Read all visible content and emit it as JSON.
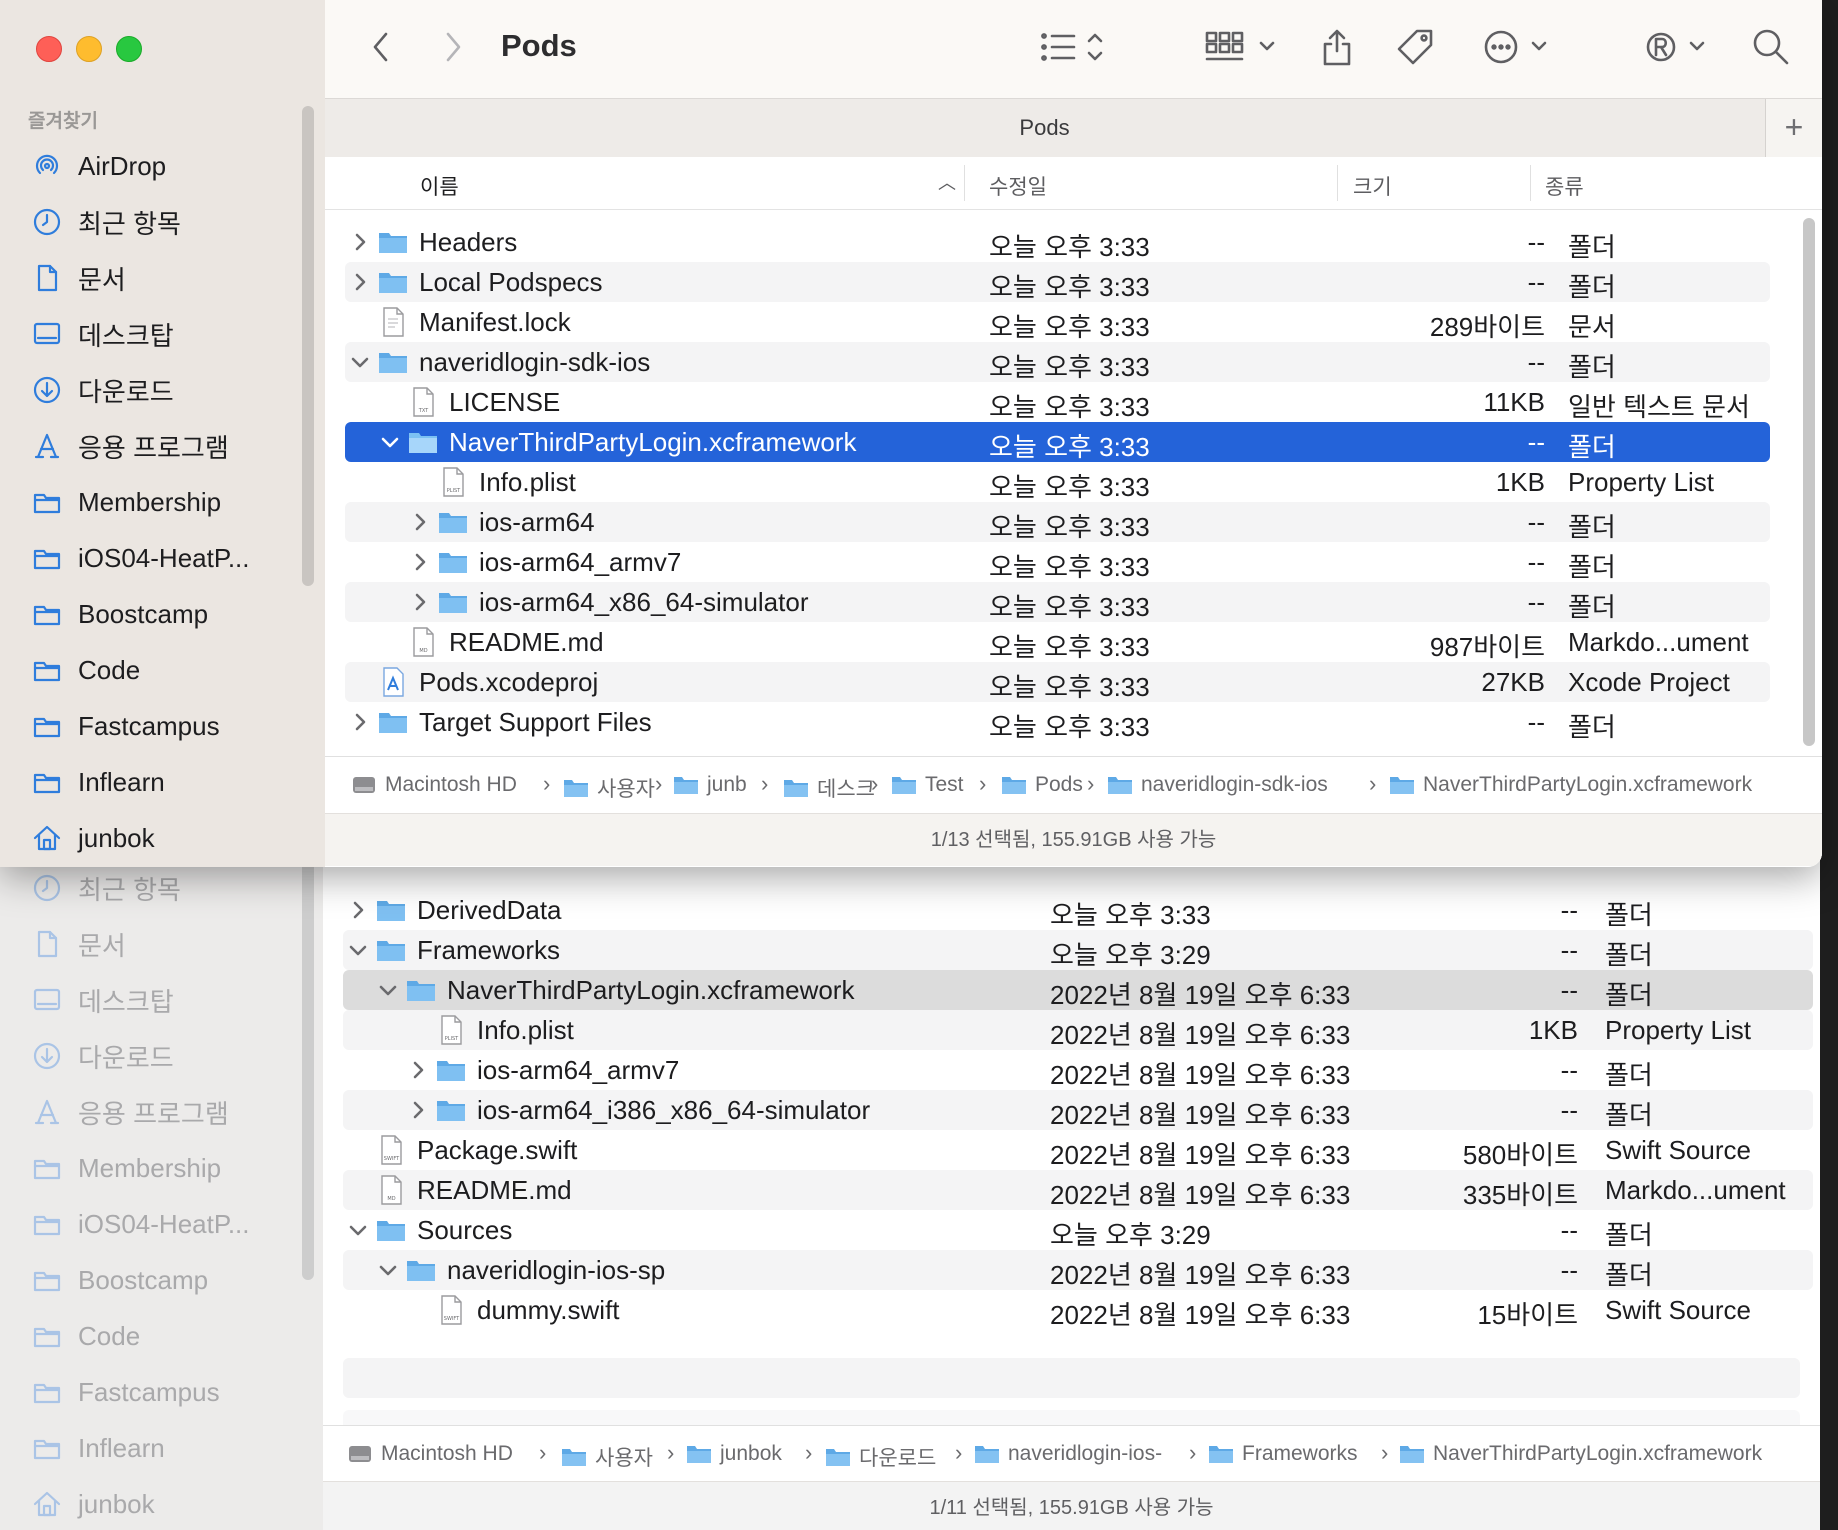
{
  "front": {
    "toolbar": {
      "title": "Pods"
    },
    "tab": {
      "label": "Pods",
      "plus": "+"
    },
    "sidebar": {
      "section": "즐겨찾기",
      "items": [
        {
          "label": "AirDrop",
          "icon": "airdrop-icon"
        },
        {
          "label": "최근 항목",
          "icon": "clock-icon"
        },
        {
          "label": "문서",
          "icon": "document-icon"
        },
        {
          "label": "데스크탑",
          "icon": "desktop-icon"
        },
        {
          "label": "다운로드",
          "icon": "download-icon"
        },
        {
          "label": "응용 프로그램",
          "icon": "applications-icon"
        },
        {
          "label": "Membership",
          "icon": "folder-icon"
        },
        {
          "label": "iOS04-HeatP...",
          "icon": "folder-icon"
        },
        {
          "label": "Boostcamp",
          "icon": "folder-icon"
        },
        {
          "label": "Code",
          "icon": "folder-icon"
        },
        {
          "label": "Fastcampus",
          "icon": "folder-icon"
        },
        {
          "label": "Inflearn",
          "icon": "folder-icon"
        },
        {
          "label": "junbok",
          "icon": "home-icon"
        }
      ]
    },
    "columns": {
      "name": "이름",
      "modified": "수정일",
      "size": "크기",
      "kind": "종류"
    },
    "rows": [
      {
        "name": "Headers",
        "date": "오늘 오후 3:33",
        "size": "--",
        "kind": "폴더"
      },
      {
        "name": "Local Podspecs",
        "date": "오늘 오후 3:33",
        "size": "--",
        "kind": "폴더"
      },
      {
        "name": "Manifest.lock",
        "date": "오늘 오후 3:33",
        "size": "289바이트",
        "kind": "문서"
      },
      {
        "name": "naveridlogin-sdk-ios",
        "date": "오늘 오후 3:33",
        "size": "--",
        "kind": "폴더"
      },
      {
        "name": "LICENSE",
        "date": "오늘 오후 3:33",
        "size": "11KB",
        "kind": "일반 텍스트 문서"
      },
      {
        "name": "NaverThirdPartyLogin.xcframework",
        "date": "오늘 오후 3:33",
        "size": "--",
        "kind": "폴더"
      },
      {
        "name": "Info.plist",
        "date": "오늘 오후 3:33",
        "size": "1KB",
        "kind": "Property List"
      },
      {
        "name": "ios-arm64",
        "date": "오늘 오후 3:33",
        "size": "--",
        "kind": "폴더"
      },
      {
        "name": "ios-arm64_armv7",
        "date": "오늘 오후 3:33",
        "size": "--",
        "kind": "폴더"
      },
      {
        "name": "ios-arm64_x86_64-simulator",
        "date": "오늘 오후 3:33",
        "size": "--",
        "kind": "폴더"
      },
      {
        "name": "README.md",
        "date": "오늘 오후 3:33",
        "size": "987바이트",
        "kind": "Markdo...ument"
      },
      {
        "name": "Pods.xcodeproj",
        "date": "오늘 오후 3:33",
        "size": "27KB",
        "kind": "Xcode Project"
      },
      {
        "name": "Target Support Files",
        "date": "오늘 오후 3:33",
        "size": "--",
        "kind": "폴더"
      }
    ],
    "path": [
      "Macintosh HD",
      "사용자",
      "junb",
      "데스크",
      "Test",
      "Pods",
      "naveridlogin-sdk-ios",
      "NaverThirdPartyLogin.xcframework"
    ],
    "status": "1/13 선택됨, 155.91GB 사용 가능"
  },
  "back": {
    "sidebar": {
      "items": [
        {
          "label": "최근 항목",
          "icon": "clock-icon"
        },
        {
          "label": "문서",
          "icon": "document-icon"
        },
        {
          "label": "데스크탑",
          "icon": "desktop-icon"
        },
        {
          "label": "다운로드",
          "icon": "download-icon"
        },
        {
          "label": "응용 프로그램",
          "icon": "applications-icon"
        },
        {
          "label": "Membership",
          "icon": "folder-icon"
        },
        {
          "label": "iOS04-HeatP...",
          "icon": "folder-icon"
        },
        {
          "label": "Boostcamp",
          "icon": "folder-icon"
        },
        {
          "label": "Code",
          "icon": "folder-icon"
        },
        {
          "label": "Fastcampus",
          "icon": "folder-icon"
        },
        {
          "label": "Inflearn",
          "icon": "folder-icon"
        },
        {
          "label": "junbok",
          "icon": "home-icon"
        }
      ]
    },
    "rows": [
      {
        "name": "DerivedData",
        "date": "오늘 오후 3:33",
        "size": "--",
        "kind": "폴더"
      },
      {
        "name": "Frameworks",
        "date": "오늘 오후 3:29",
        "size": "--",
        "kind": "폴더"
      },
      {
        "name": "NaverThirdPartyLogin.xcframework",
        "date": "2022년 8월 19일 오후 6:33",
        "size": "--",
        "kind": "폴더"
      },
      {
        "name": "Info.plist",
        "date": "2022년 8월 19일 오후 6:33",
        "size": "1KB",
        "kind": "Property List"
      },
      {
        "name": "ios-arm64_armv7",
        "date": "2022년 8월 19일 오후 6:33",
        "size": "--",
        "kind": "폴더"
      },
      {
        "name": "ios-arm64_i386_x86_64-simulator",
        "date": "2022년 8월 19일 오후 6:33",
        "size": "--",
        "kind": "폴더"
      },
      {
        "name": "Package.swift",
        "date": "2022년 8월 19일 오후 6:33",
        "size": "580바이트",
        "kind": "Swift Source"
      },
      {
        "name": "README.md",
        "date": "2022년 8월 19일 오후 6:33",
        "size": "335바이트",
        "kind": "Markdo...ument"
      },
      {
        "name": "Sources",
        "date": "오늘 오후 3:29",
        "size": "--",
        "kind": "폴더"
      },
      {
        "name": "naveridlogin-ios-sp",
        "date": "2022년 8월 19일 오후 6:33",
        "size": "--",
        "kind": "폴더"
      },
      {
        "name": "dummy.swift",
        "date": "2022년 8월 19일 오후 6:33",
        "size": "15바이트",
        "kind": "Swift Source"
      }
    ],
    "path": [
      "Macintosh HD",
      "사용자",
      "junbok",
      "다운로드",
      "naveridlogin-ios-",
      "Frameworks",
      "NaverThirdPartyLogin.xcframework"
    ],
    "status": "1/11 선택됨, 155.91GB 사용 가능"
  },
  "colors": {
    "selection": "#2463d9",
    "folder": "#6cb4ef",
    "accent": "#2f7ddc"
  }
}
